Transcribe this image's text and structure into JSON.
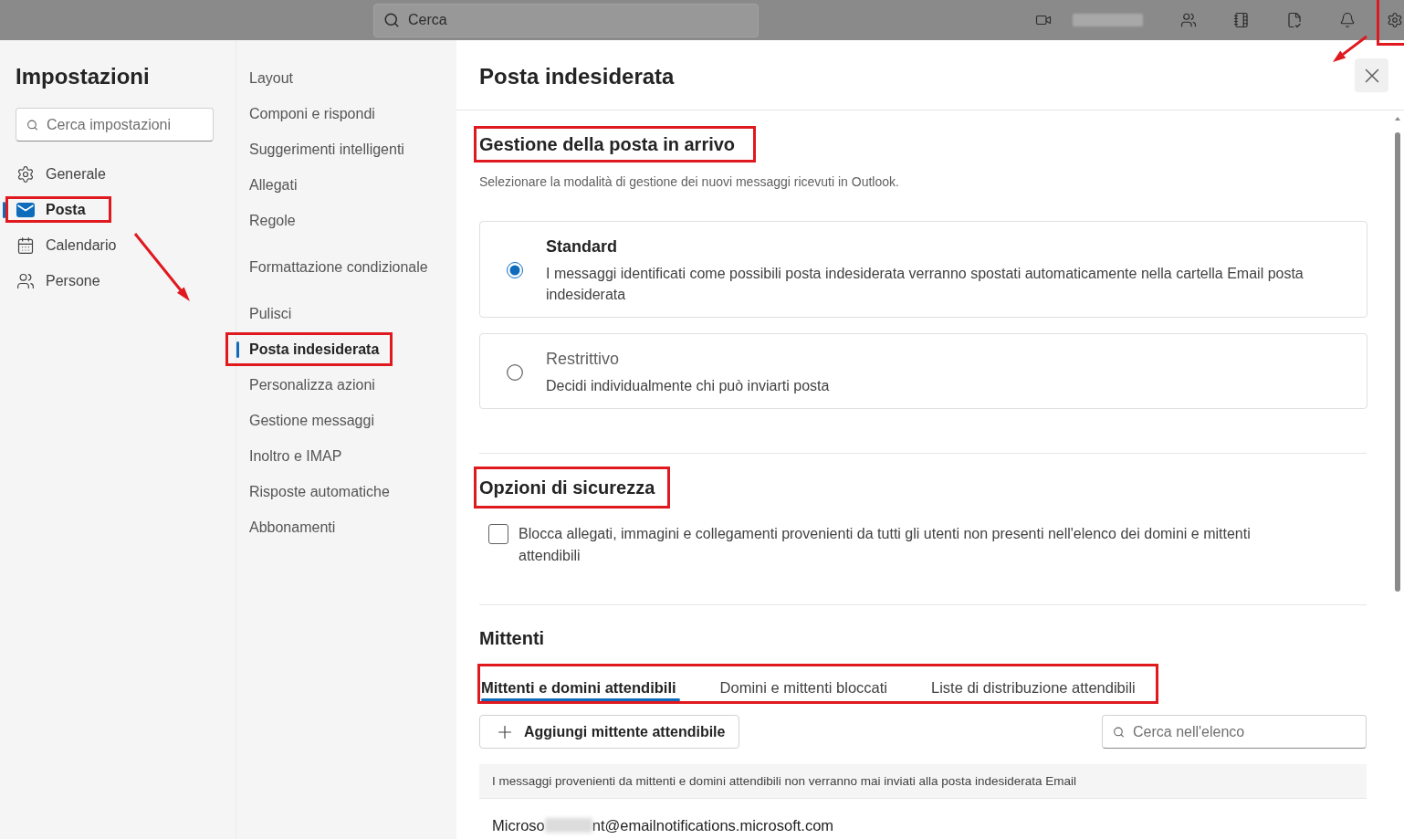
{
  "top_bar": {
    "search": {
      "placeholder": "Cerca"
    },
    "settings_button": {
      "highlighted": true
    }
  },
  "settings": {
    "title": "Impostazioni",
    "search": {
      "placeholder": "Cerca impostazioni"
    },
    "categories": [
      {
        "kind": "general",
        "label": "Generale",
        "selected": false,
        "highlighted": false
      },
      {
        "kind": "mail",
        "label": "Posta",
        "selected": true,
        "highlighted": true
      },
      {
        "kind": "calendar",
        "label": "Calendario",
        "selected": false,
        "highlighted": false
      },
      {
        "kind": "people",
        "label": "Persone",
        "selected": false,
        "highlighted": false
      }
    ]
  },
  "mail_menu": {
    "groups": [
      {
        "items": [
          {
            "label": "Layout",
            "selected": false,
            "highlighted": false
          },
          {
            "label": "Componi e rispondi",
            "selected": false,
            "highlighted": false
          },
          {
            "label": "Suggerimenti intelligenti",
            "selected": false,
            "highlighted": false
          },
          {
            "label": "Allegati",
            "selected": false,
            "highlighted": false
          },
          {
            "label": "Regole",
            "selected": false,
            "highlighted": false
          }
        ]
      },
      {
        "items": [
          {
            "label": "Formattazione condizionale",
            "selected": false,
            "highlighted": false
          }
        ]
      },
      {
        "items": [
          {
            "label": "Pulisci",
            "selected": false,
            "highlighted": false
          },
          {
            "label": "Posta indesiderata",
            "selected": true,
            "highlighted": true
          },
          {
            "label": "Personalizza azioni",
            "selected": false,
            "highlighted": false
          },
          {
            "label": "Gestione messaggi",
            "selected": false,
            "highlighted": false
          },
          {
            "label": "Inoltro e IMAP",
            "selected": false,
            "highlighted": false
          },
          {
            "label": "Risposte automatiche",
            "selected": false,
            "highlighted": false
          },
          {
            "label": "Abbonamenti",
            "selected": false,
            "highlighted": false
          }
        ]
      }
    ]
  },
  "panel": {
    "title": "Posta indesiderata",
    "inbox_handling": {
      "heading": "Gestione della posta in arrivo",
      "highlighted": true,
      "description": "Selezionare la modalità di gestione dei nuovi messaggi ricevuti in Outlook.",
      "options": [
        {
          "label": "Standard",
          "description": "I messaggi identificati come possibili posta indesiderata verranno spostati automaticamente nella cartella Email posta indesiderata",
          "selected": true
        },
        {
          "label": "Restrittivo",
          "description": "Decidi individualmente chi può inviarti posta",
          "selected": false
        }
      ]
    },
    "security": {
      "heading": "Opzioni di sicurezza",
      "highlighted": true,
      "options": [
        {
          "label": "Blocca allegati, immagini e collegamenti provenienti da tutti gli utenti non presenti nell'elenco dei domini e mittenti attendibili",
          "checked": false
        }
      ]
    },
    "senders": {
      "heading": "Mittenti",
      "tab_bar": {
        "highlighted": true,
        "tabs": [
          {
            "label": "Mittenti e domini attendibili",
            "selected": true
          },
          {
            "label": "Domini e mittenti bloccati",
            "selected": false
          },
          {
            "label": "Liste di distribuzione attendibili",
            "selected": false
          }
        ]
      },
      "add_button": "Aggiungi mittente attendibile",
      "search": {
        "placeholder": "Cerca nell'elenco"
      },
      "notice": "I messaggi provenienti da mittenti e domini attendibili non verranno mai inviati alla posta indesiderata Email",
      "entries": [
        {
          "address_start": "Microso",
          "address_end": "nt@emailnotifications.microsoft.com"
        }
      ]
    }
  }
}
